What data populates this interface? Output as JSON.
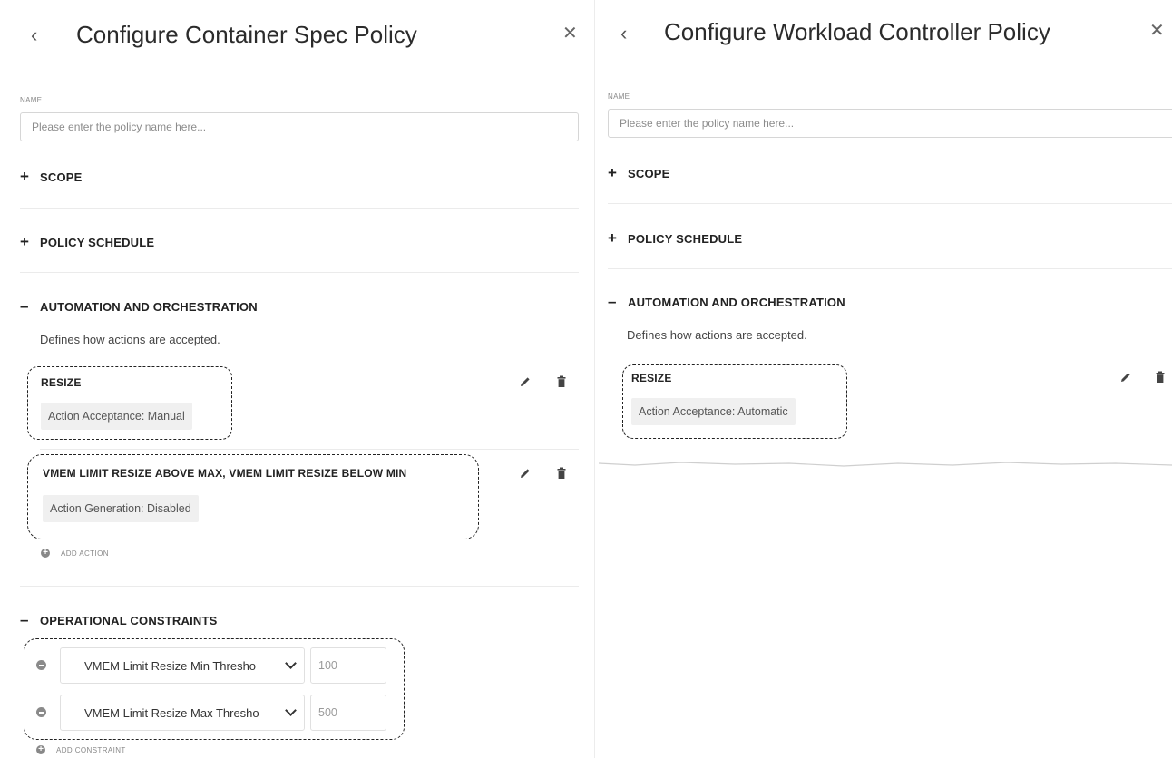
{
  "left": {
    "title": "Configure Container Spec Policy",
    "back_glyph": "‹",
    "close_glyph": "✕",
    "name_label": "NAME",
    "name_placeholder": "Please enter the policy name here...",
    "scope_label": "SCOPE",
    "schedule_label": "POLICY SCHEDULE",
    "automation_label": "AUTOMATION AND ORCHESTRATION",
    "automation_desc": "Defines how actions are accepted.",
    "actions": [
      {
        "title": "RESIZE",
        "setting": "Action Acceptance: Manual"
      },
      {
        "title": "VMEM LIMIT RESIZE ABOVE MAX, VMEM LIMIT RESIZE BELOW MIN",
        "setting": "Action Generation: Disabled"
      }
    ],
    "add_action_label": "ADD ACTION",
    "constraints_label": "OPERATIONAL CONSTRAINTS",
    "constraints": [
      {
        "select": "VMEM Limit Resize Min Thresho",
        "value": "100"
      },
      {
        "select": "VMEM Limit Resize Max Thresho",
        "value": "500"
      }
    ],
    "add_constraint_label": "ADD CONSTRAINT"
  },
  "right": {
    "title": "Configure Workload Controller Policy",
    "back_glyph": "‹",
    "close_glyph": "✕",
    "name_label": "NAME",
    "name_placeholder": "Please enter the policy name here...",
    "scope_label": "SCOPE",
    "schedule_label": "POLICY SCHEDULE",
    "automation_label": "AUTOMATION AND ORCHESTRATION",
    "automation_desc": "Defines how actions are accepted.",
    "actions": [
      {
        "title": "RESIZE",
        "setting": "Action Acceptance: Automatic"
      }
    ]
  },
  "symbols": {
    "expand": "+",
    "collapse": "–"
  },
  "icons": {
    "edit": "pencil-icon",
    "delete": "trash-icon",
    "add": "plus-circle-icon",
    "remove": "minus-circle-icon"
  }
}
